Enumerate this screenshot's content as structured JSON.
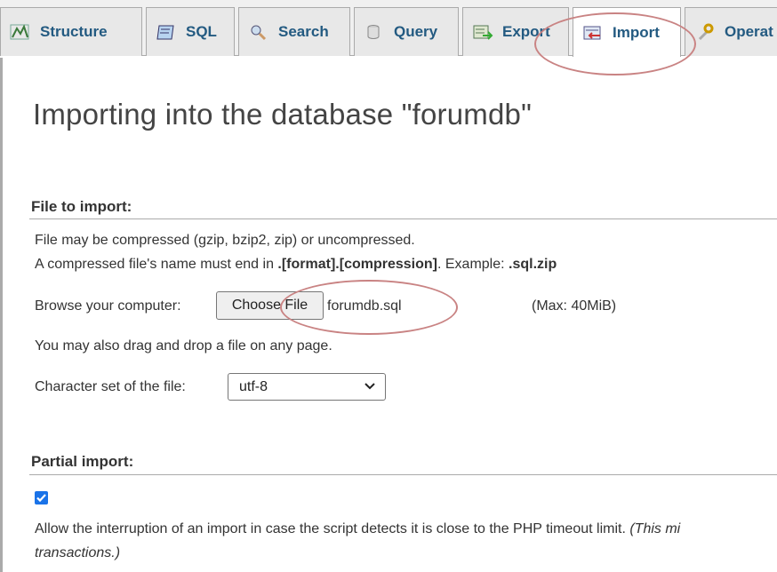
{
  "tabs": [
    {
      "label": "Structure",
      "icon": "structure-icon"
    },
    {
      "label": "SQL",
      "icon": "sql-icon"
    },
    {
      "label": "Search",
      "icon": "search-icon"
    },
    {
      "label": "Query",
      "icon": "query-icon"
    },
    {
      "label": "Export",
      "icon": "export-icon"
    },
    {
      "label": "Import",
      "icon": "import-icon",
      "active": true
    },
    {
      "label": "Operat",
      "icon": "operations-icon"
    }
  ],
  "page": {
    "title": "Importing into the database \"forumdb\""
  },
  "file_import": {
    "section_title": "File to import:",
    "line1": "File may be compressed (gzip, bzip2, zip) or uncompressed.",
    "line2_prefix": "A compressed file's name must end in ",
    "line2_bold": ".[format].[compression]",
    "line2_mid": ". Example: ",
    "line2_example": ".sql.zip",
    "browse_label": "Browse your computer:",
    "choose_button": "Choose File",
    "file_name": "forumdb.sql",
    "max_size": "(Max: 40MiB)",
    "drag_note": "You may also drag and drop a file on any page.",
    "charset_label": "Character set of the file:",
    "charset_value": "utf-8"
  },
  "partial_import": {
    "section_title": "Partial import:",
    "checkbox_checked": true,
    "allow_text": "Allow the interruption of an import in case the script detects it is close to the PHP timeout limit. ",
    "allow_italic": "(This mi",
    "allow_line2_italic": "transactions.)"
  },
  "colors": {
    "tab_text": "#235a81",
    "annotation": "#c98383",
    "checkbox": "#1a73e8"
  }
}
